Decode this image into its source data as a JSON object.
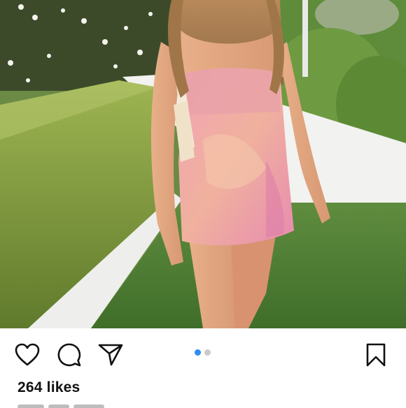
{
  "post": {
    "likes_text": "264 likes",
    "carousel": {
      "count": 2,
      "active_index": 0
    }
  },
  "colors": {
    "active_dot": "#2f8bf0",
    "inactive_dot": "#c9c9c9",
    "icon": "#111111"
  },
  "icons": {
    "like": "heart-icon",
    "comment": "comment-bubble-icon",
    "share": "paper-plane-icon",
    "save": "bookmark-icon"
  }
}
